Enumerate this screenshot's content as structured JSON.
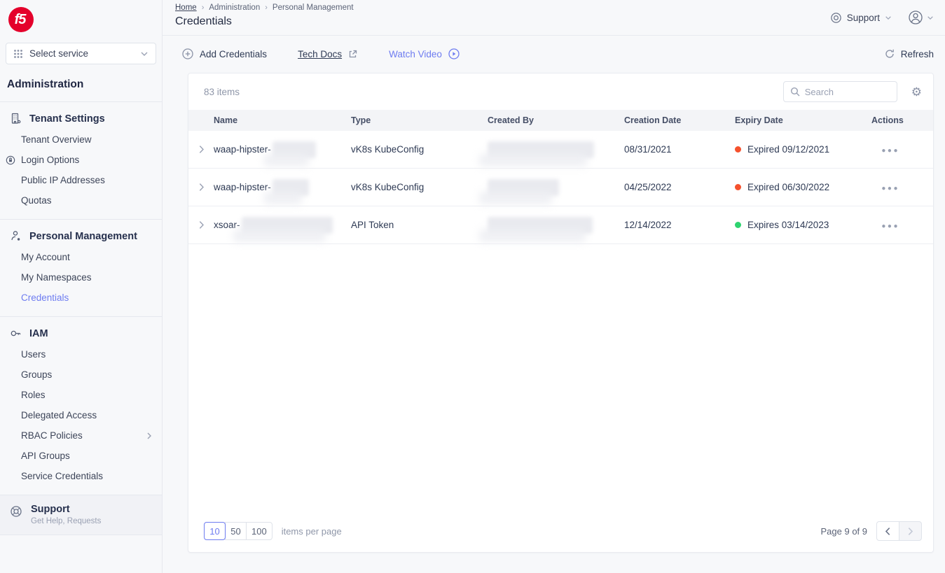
{
  "colors": {
    "brand_red": "#e4002b",
    "accent_link": "#6e7cf0",
    "status_expired": "#f5512d",
    "status_valid": "#2ed36f"
  },
  "brand": {
    "logo_text": "f5"
  },
  "sidebar": {
    "service_selector_label": "Select service",
    "admin_title": "Administration",
    "groups": [
      {
        "title": "Tenant Settings",
        "items": [
          {
            "label": "Tenant Overview"
          },
          {
            "label": "Login Options"
          },
          {
            "label": "Public IP Addresses"
          },
          {
            "label": "Quotas"
          }
        ]
      },
      {
        "title": "Personal Management",
        "items": [
          {
            "label": "My Account"
          },
          {
            "label": "My Namespaces"
          },
          {
            "label": "Credentials"
          }
        ]
      },
      {
        "title": "IAM",
        "items": [
          {
            "label": "Users"
          },
          {
            "label": "Groups"
          },
          {
            "label": "Roles"
          },
          {
            "label": "Delegated Access"
          },
          {
            "label": "RBAC Policies"
          },
          {
            "label": "API Groups"
          },
          {
            "label": "Service Credentials"
          }
        ]
      }
    ],
    "support_title": "Support",
    "support_subtitle": "Get Help, Requests"
  },
  "header": {
    "breadcrumb": {
      "home": "Home",
      "section": "Administration",
      "subsection": "Personal Management"
    },
    "title": "Credentials",
    "support_label": "Support"
  },
  "toolbar": {
    "add_label": "Add Credentials",
    "tech_docs_label": "Tech Docs",
    "watch_video_label": "Watch Video",
    "refresh_label": "Refresh"
  },
  "table": {
    "items_count": "83 items",
    "search_placeholder": "Search",
    "columns": [
      "Name",
      "Type",
      "Created By",
      "Creation Date",
      "Expiry Date",
      "Actions"
    ],
    "rows": [
      {
        "name_prefix": "waap-hipster-",
        "type": "vK8s KubeConfig",
        "creation_date": "08/31/2021",
        "expiry_label": "Expired 09/12/2021",
        "status": "expired"
      },
      {
        "name_prefix": "waap-hipster-",
        "type": "vK8s KubeConfig",
        "creation_date": "04/25/2022",
        "expiry_label": "Expired 06/30/2022",
        "status": "expired"
      },
      {
        "name_prefix": "xsoar-",
        "type": "API Token",
        "creation_date": "12/14/2022",
        "expiry_label": "Expires 03/14/2023",
        "status": "valid"
      }
    ]
  },
  "pagination": {
    "page_sizes": [
      "10",
      "50",
      "100"
    ],
    "selected_size": "10",
    "per_page_label": "items per page",
    "page_label": "Page 9 of 9"
  }
}
